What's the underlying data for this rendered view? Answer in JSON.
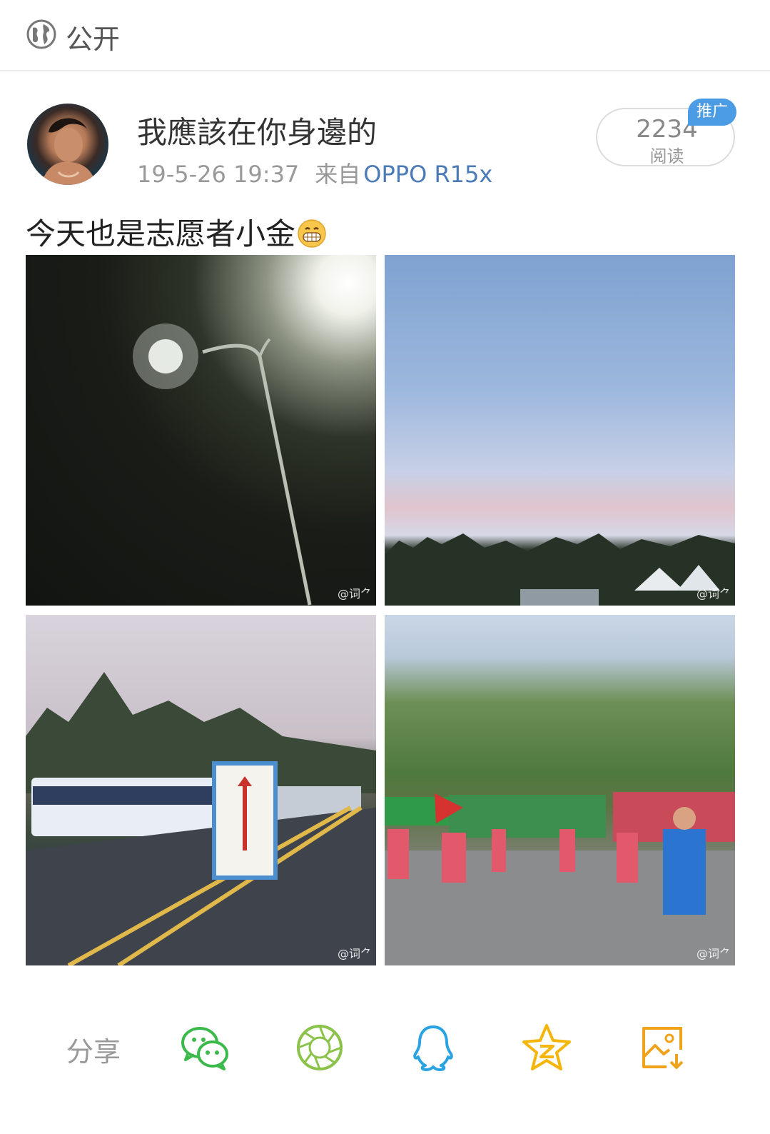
{
  "privacy": {
    "icon": "globe-icon",
    "label": "公开"
  },
  "post": {
    "username": "我應該在你身邊的",
    "timestamp": "19-5-26 19:37",
    "source_prefix": "来自",
    "device": "OPPO R15x",
    "reads_count": "2234",
    "reads_label": "阅读",
    "promo_badge": "推广",
    "text": "今天也是志愿者小金",
    "emoji": "grin-emoji"
  },
  "photos": [
    {
      "watermark": "@词⺈",
      "scene": "street-lamp-night"
    },
    {
      "watermark": "@词⺈",
      "scene": "evening-sky-trees"
    },
    {
      "watermark": "@词⺈",
      "scene": "road-buses-sign"
    },
    {
      "watermark": "@词⺈",
      "scene": "marathon-crowd"
    }
  ],
  "share": {
    "label": "分享",
    "targets": [
      "wechat-icon",
      "moments-icon",
      "qq-icon",
      "qzone-icon",
      "save-image-icon"
    ]
  },
  "colors": {
    "link": "#4a7bb8",
    "badge": "#4c9be5",
    "wechat": "#3bb94a",
    "moments": "#8bc34a",
    "qq": "#2aa3e3",
    "qzone": "#f5b50a",
    "save": "#f0a21a"
  }
}
